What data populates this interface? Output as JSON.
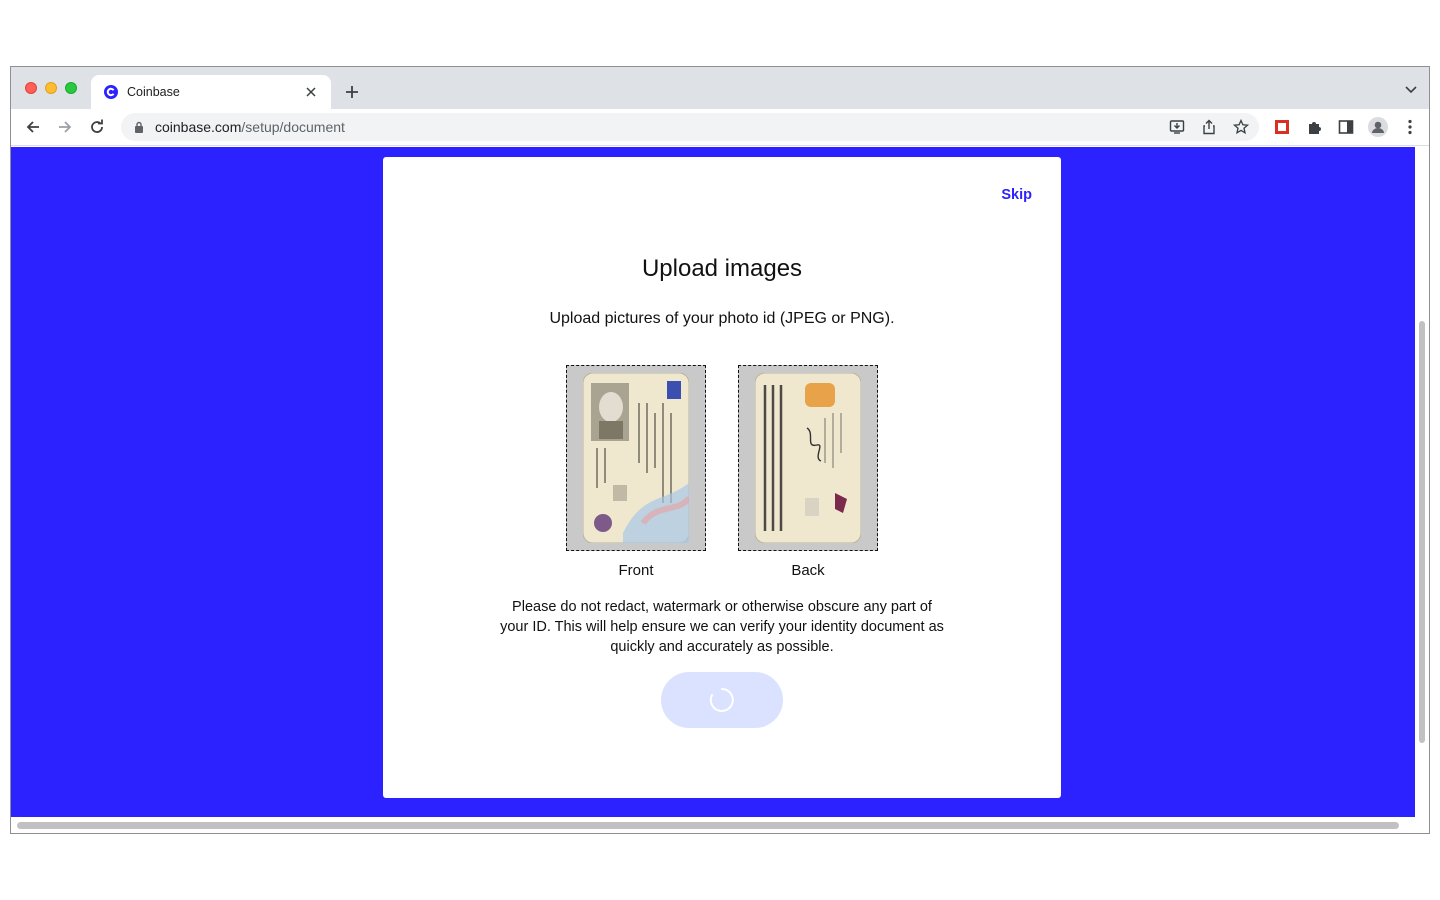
{
  "browser": {
    "tab_title": "Coinbase",
    "url_host": "coinbase.com",
    "url_path": "/setup/document"
  },
  "page": {
    "skip_label": "Skip",
    "heading": "Upload images",
    "subtitle": "Upload pictures of your photo id (JPEG or PNG).",
    "front_label": "Front",
    "back_label": "Back",
    "notice": "Please do not redact, watermark or otherwise obscure any part of your ID. This will help ensure we can verify your identity document as quickly and accurately as possible."
  },
  "colors": {
    "brand_blue": "#2b22ff",
    "button_disabled": "#dbe2ff"
  },
  "icons": [
    "back-arrow-icon",
    "forward-arrow-icon",
    "reload-icon",
    "lock-icon",
    "install-icon",
    "share-icon",
    "star-icon",
    "extension-red-icon",
    "puzzle-icon",
    "side-panel-icon",
    "profile-icon",
    "kebab-menu-icon",
    "spinner-icon"
  ]
}
